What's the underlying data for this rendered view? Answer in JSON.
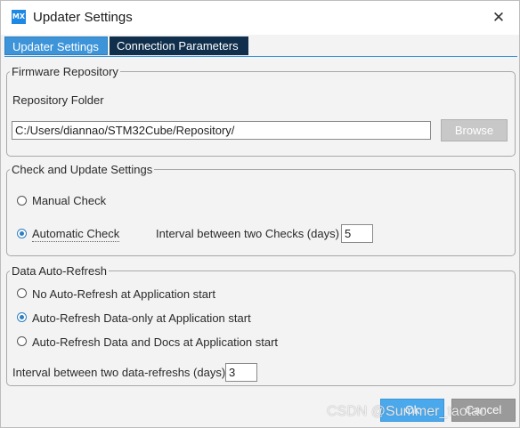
{
  "window": {
    "logo_text": "MX",
    "title": "Updater Settings",
    "close_symbol": "✕"
  },
  "tabs": [
    {
      "label": "Updater Settings",
      "active": true
    },
    {
      "label": "Connection Parameters",
      "active": false
    }
  ],
  "firmware_repository": {
    "legend": "Firmware Repository",
    "folder_label": "Repository Folder",
    "folder_value": "C:/Users/diannao/STM32Cube/Repository/",
    "browse_label": "Browse"
  },
  "check_update": {
    "legend": "Check and Update Settings",
    "manual_label": "Manual Check",
    "automatic_label": "Automatic Check",
    "selected": "automatic",
    "interval_label": "Interval between two Checks (days)",
    "interval_value": "5"
  },
  "auto_refresh": {
    "legend": "Data Auto-Refresh",
    "options": [
      {
        "label": "No Auto-Refresh at Application start",
        "selected": false
      },
      {
        "label": "Auto-Refresh Data-only at Application start",
        "selected": true
      },
      {
        "label": "Auto-Refresh Data and Docs at Application start",
        "selected": false
      }
    ],
    "interval_label": "Interval between two data-refreshs (days)",
    "interval_value": "3"
  },
  "footer": {
    "ok_label": "Ok",
    "cancel_label": "Cancel"
  },
  "watermark": "CSDN @Summer_taotao",
  "colors": {
    "accent": "#3d94d8",
    "tab_inactive": "#0f2f4c",
    "ok_button": "#4aa8ec",
    "disabled_button": "#c8c8c8"
  }
}
